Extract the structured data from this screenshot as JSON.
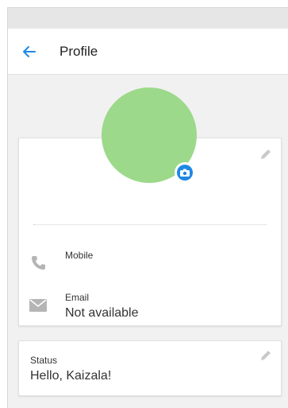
{
  "header": {
    "title": "Profile"
  },
  "profile_card": {
    "mobile_label": "Mobile",
    "email_label": "Email",
    "email_value": "Not available"
  },
  "status_card": {
    "label": "Status",
    "value": "Hello, Kaizala!"
  },
  "icons": {
    "back": "arrow-left-icon",
    "edit": "pencil-icon",
    "phone": "phone-icon",
    "email": "envelope-icon",
    "camera": "camera-icon"
  },
  "colors": {
    "accent": "#1e88e5",
    "avatar": "#9cd98a",
    "icon_grey": "#b5b5b5"
  }
}
